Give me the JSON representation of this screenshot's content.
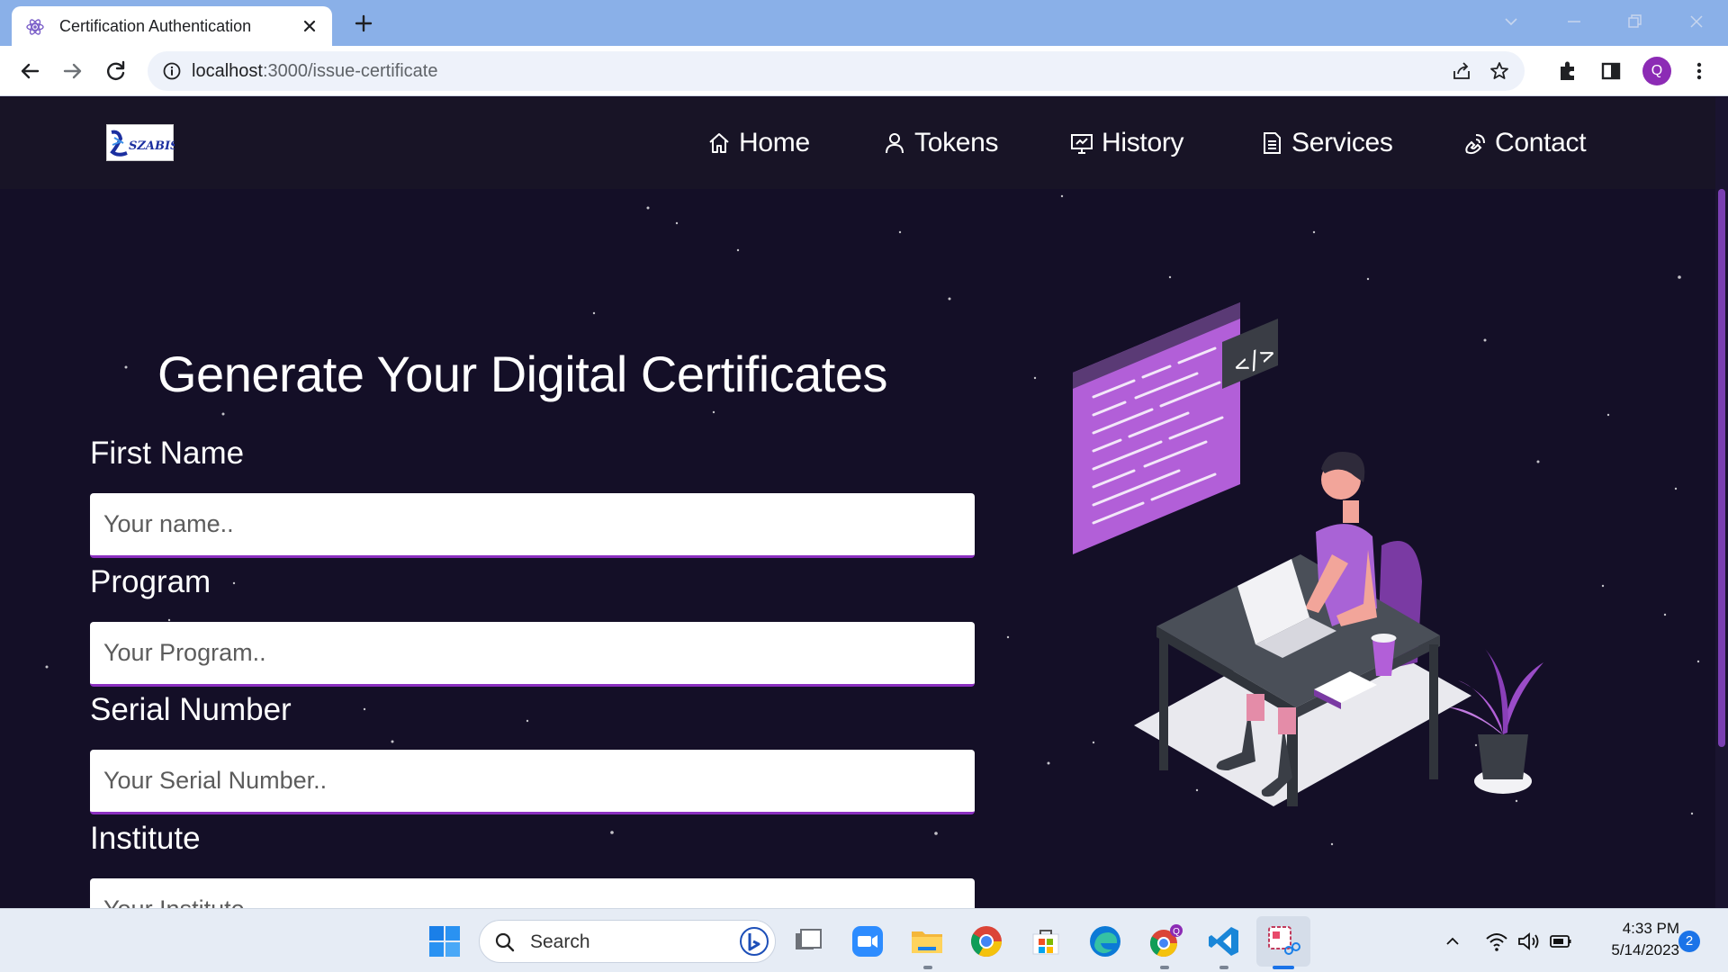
{
  "browser": {
    "tab_title": "Certification Authentication",
    "url_host": "localhost",
    "url_path": ":3000/issue-certificate",
    "profile_initial": "Q"
  },
  "header": {
    "logo_text": "SZABIST",
    "nav": [
      {
        "label": "Home",
        "icon": "home-icon"
      },
      {
        "label": "Tokens",
        "icon": "user-icon"
      },
      {
        "label": "History",
        "icon": "presentation-icon"
      },
      {
        "label": "Services",
        "icon": "document-icon"
      },
      {
        "label": "Contact",
        "icon": "phone-icon"
      }
    ]
  },
  "form": {
    "heading": "Generate Your Digital Certificates",
    "fields": [
      {
        "label": "First Name",
        "placeholder": "Your name.."
      },
      {
        "label": "Program",
        "placeholder": "Your Program.."
      },
      {
        "label": "Serial Number",
        "placeholder": "Your Serial Number.."
      },
      {
        "label": "Institute",
        "placeholder": "Your Institute.."
      }
    ]
  },
  "illustration": {
    "code_badge": "</>"
  },
  "taskbar": {
    "search_label": "Search",
    "time": "4:33 PM",
    "date": "5/14/2023",
    "notification_count": "2",
    "chrome_badge": "Q"
  },
  "colors": {
    "page_bg": "#140f27",
    "header_bg": "#181426",
    "accent_purple": "#8b2fc0",
    "tabbar": "#8ab0e8"
  }
}
